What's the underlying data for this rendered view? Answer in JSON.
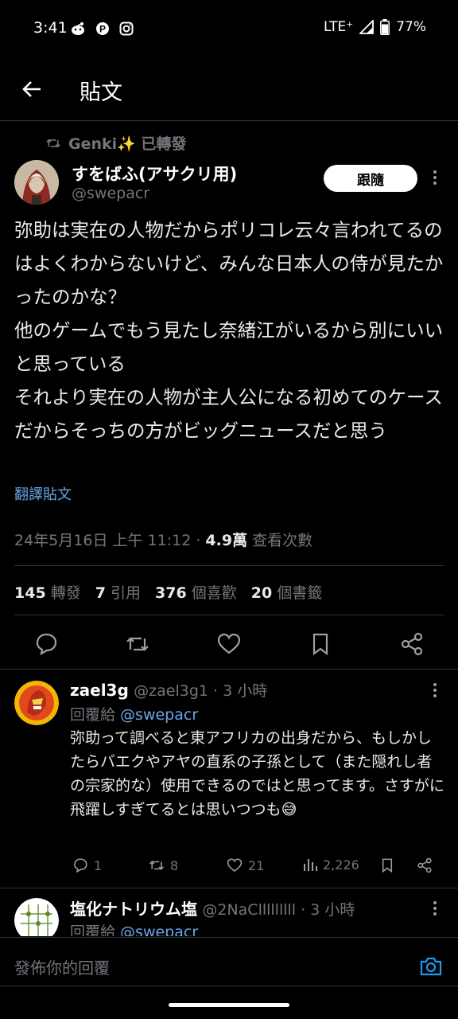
{
  "status_bar": {
    "time": "3:41",
    "network": "LTE⁺",
    "battery": "77%",
    "icons": [
      "reddit-icon",
      "p-icon",
      "instagram-icon",
      "signal-icon",
      "battery-icon"
    ]
  },
  "header": {
    "title": "貼文"
  },
  "retweet": {
    "label": "Genki✨ 已轉發"
  },
  "post": {
    "display_name": "すをばふ(アサクリ用)",
    "handle": "@swepacr",
    "follow_label": "跟隨",
    "text": "弥助は実在の人物だからポリコレ云々言われてるのはよくわからないけど、みんな日本人の侍が見たかったのかな？\n他のゲームでもう見たし奈緒江がいるから別にいいと思っている\nそれより実在の人物が主人公になる初めてのケースだからそっちの方がビッグニュースだと思う",
    "translate_label": "翻譯貼文",
    "date": "24年5月16日 上午 11:12",
    "separator": " · ",
    "views": "4.9萬",
    "views_label": " 查看次數",
    "stats": [
      {
        "value": "145",
        "label": " 轉發"
      },
      {
        "value": "7",
        "label": " 引用"
      },
      {
        "value": "376",
        "label": " 個喜歡"
      },
      {
        "value": "20",
        "label": " 個書籤"
      }
    ]
  },
  "replies": [
    {
      "display_name": "zael3g",
      "handle_time": "@zael3g1 · 3 小時",
      "reply_to_prefix": "回覆給 ",
      "reply_to": "@swepacr",
      "text": "弥助って調べると東アフリカの出身だから、もしかしたらバエクやアヤの直系の子孫として（また隠れし者の宗家的な）使用できるのではと思ってます。さすがに飛躍しすぎてるとは思いつつも😅",
      "replies": "1",
      "retweets": "8",
      "likes": "21",
      "views": "2,226"
    },
    {
      "display_name": "塩化ナトリウム塩",
      "handle_time": "@2NaClllllllll · 3 小時",
      "reply_to_prefix": "回覆給 ",
      "reply_to": "@swepacr"
    }
  ],
  "composer": {
    "placeholder": "發佈你的回覆"
  },
  "colors": {
    "background": "#000000",
    "link": "#6aa6e8",
    "muted": "#71767b"
  }
}
